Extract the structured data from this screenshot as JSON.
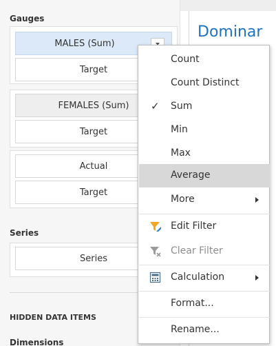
{
  "dashboard": {
    "title": "Dominar"
  },
  "left_panel": {
    "gauges_label": "Gauges",
    "series_label": "Series",
    "hidden_data_items_label": "HIDDEN DATA ITEMS",
    "dimensions_label": "Dimensions",
    "gauge_groups": [
      {
        "value": "MALES (Sum)",
        "target": "Target"
      },
      {
        "value": "FEMALES (Sum)",
        "target": "Target"
      },
      {
        "value": "Actual",
        "target": "Target"
      }
    ],
    "series_slot": "Series"
  },
  "context_menu": {
    "items": [
      {
        "label": "Count"
      },
      {
        "label": "Count Distinct"
      },
      {
        "label": "Sum",
        "checked": true
      },
      {
        "label": "Min"
      },
      {
        "label": "Max"
      },
      {
        "label": "Average",
        "highlighted": true
      },
      {
        "label": "More",
        "submenu": true
      },
      {
        "label": "Edit Filter",
        "icon": "filter-icon"
      },
      {
        "label": "Clear Filter",
        "icon": "clear-filter-icon",
        "disabled": true
      },
      {
        "label": "Calculation",
        "icon": "calculator-icon",
        "submenu": true
      },
      {
        "label": "Format..."
      },
      {
        "label": "Rename..."
      }
    ],
    "check_glyph": "✓"
  },
  "colors": {
    "accent": "#1f72c2",
    "active_slot": "#dbe9f8",
    "menu_highlight": "#d8d8d8",
    "filter_orange": "#f5a524",
    "filter_blue": "#2d78c8"
  }
}
